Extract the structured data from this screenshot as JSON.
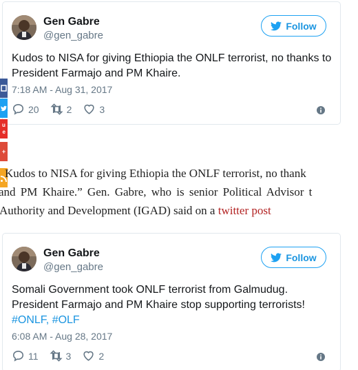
{
  "tweets": [
    {
      "name": "Gen Gabre",
      "handle": "@gen_gabre",
      "follow_label": "Follow",
      "text_lines": [
        "Kudos to NISA for giving Ethiopia the ONLF terrorist, no thanks to",
        "President Farmajo and PM Khaire."
      ],
      "timestamp": "7:18 AM - Aug 31, 2017",
      "replies": "20",
      "retweets": "2",
      "likes": "3"
    },
    {
      "name": "Gen Gabre",
      "handle": "@gen_gabre",
      "follow_label": "Follow",
      "text_lines": [
        "Somali Government took ONLF terrorist from Galmudug.",
        "President Farmajo and PM Khaire stop supporting terrorists!"
      ],
      "hashtags": "#ONLF, #OLF",
      "timestamp": "6:08 AM - Aug 28, 2017",
      "replies": "11",
      "retweets": "3",
      "likes": "2"
    }
  ],
  "article": {
    "line1": "Kudos to NISA for giving Ethiopia the ONLF terrorist, no thank",
    "line2": "and PM Khaire.” Gen. Gabre, who is senior Political Advisor t",
    "line3_prefix": "Authority and Development (IGAD) said on a ",
    "link": "twitter post"
  },
  "share_bar": {
    "youtube_label": "u\ne",
    "gplus_label": "+"
  },
  "colors": {
    "twitter_blue": "#1da1f2",
    "link_red": "#b22222",
    "muted": "#657786"
  }
}
